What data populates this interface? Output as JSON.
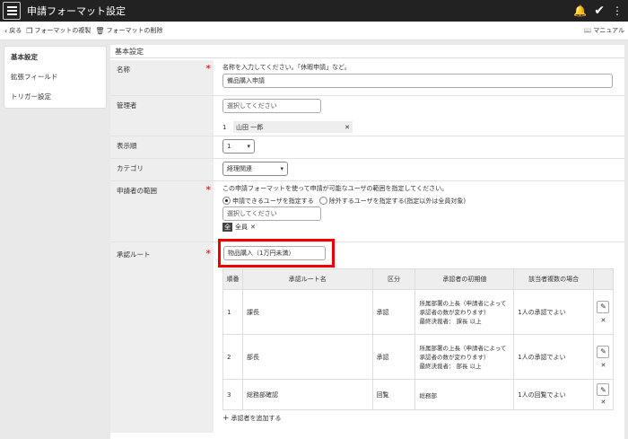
{
  "window": {
    "title": "申請フォーマット設定"
  },
  "toolbar": {
    "back": "戻る",
    "copy": "フォーマットの複製",
    "delete": "フォーマットの削除",
    "manual": "マニュアル"
  },
  "sidebar": {
    "items": [
      {
        "label": "基本設定"
      },
      {
        "label": "拡張フィールド"
      },
      {
        "label": "トリガー設定"
      }
    ]
  },
  "main": {
    "section_title": "基本設定"
  },
  "fields": {
    "name": {
      "label": "名称",
      "hint": "名称を入力してください。「休暇申請」など。",
      "value": "備品購入申請"
    },
    "admin": {
      "label": "管理者",
      "placeholder": "選択してください",
      "index": "1",
      "member": "山田 一郎"
    },
    "order": {
      "label": "表示順",
      "value": "1"
    },
    "category": {
      "label": "カテゴリ",
      "value": "経理関連"
    },
    "applicant": {
      "label": "申請者の範囲",
      "hint": "この申請フォーマットを使って申請が可能なユーザの範囲を指定してください。",
      "option1": "申請できるユーザを指定する",
      "option2": "除外するユーザを指定する(指定以外は全員対象)",
      "placeholder": "選択してください",
      "chip_icon": "全",
      "chip_label": "全員"
    },
    "route": {
      "label": "承認ルート",
      "value": "物品購入（1万円未満）",
      "add": "承認者を追加する"
    }
  },
  "route_table": {
    "headers": [
      "順番",
      "承認ルート名",
      "区分",
      "承認者の初期値",
      "該当者複数の場合"
    ],
    "rows": [
      {
        "no": "1",
        "name": "課長",
        "type": "承認",
        "initial": "所属部署の上長（申請者によって承認者の数が変わります）",
        "final": "最終決裁者： 課長 以上",
        "multi": "1人の承認でよい"
      },
      {
        "no": "2",
        "name": "部長",
        "type": "承認",
        "initial": "所属部署の上長（申請者によって承認者の数が変わります）",
        "final": "最終決裁者： 部長 以上",
        "multi": "1人の承認でよい"
      },
      {
        "no": "3",
        "name": "総務部確認",
        "type": "回覧",
        "initial": "総務部",
        "final": "",
        "multi": "1人の回覧でよい"
      }
    ]
  },
  "colors": {
    "titlebar": "#222222",
    "highlight": "#e00000",
    "required": "#dd0000"
  }
}
